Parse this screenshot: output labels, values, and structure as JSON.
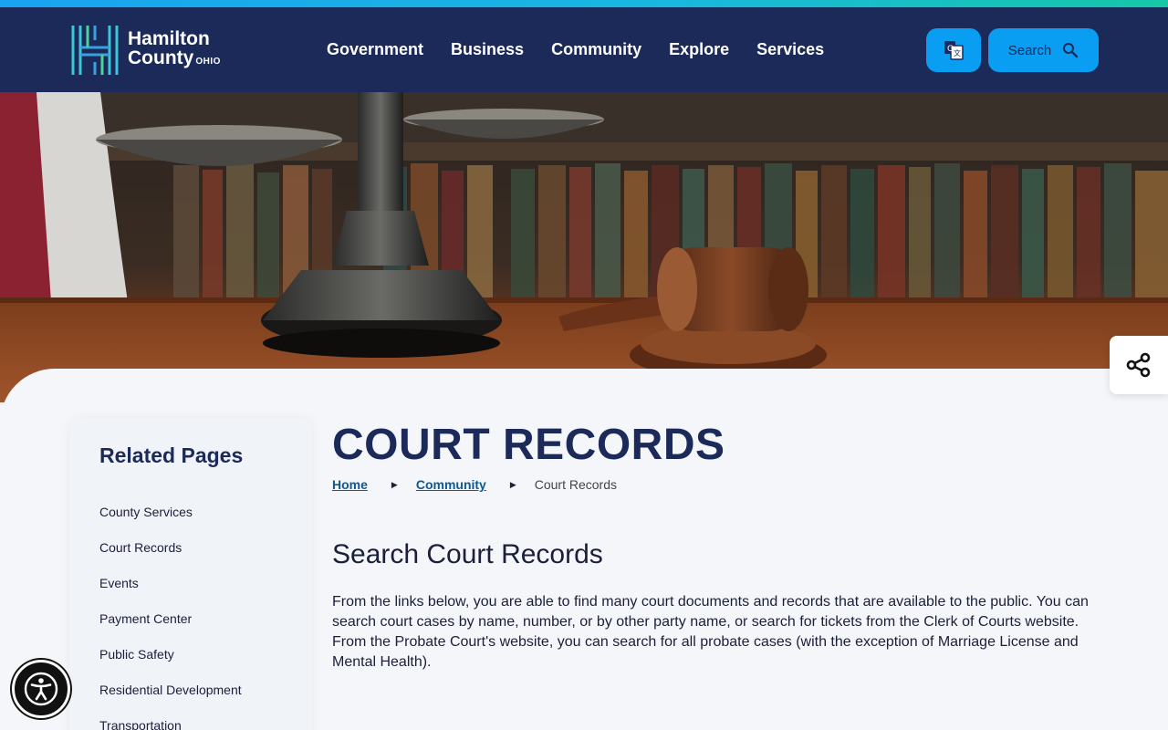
{
  "brand": {
    "line1": "Hamilton",
    "line2": "County",
    "state": "OHIO"
  },
  "nav": [
    "Government",
    "Business",
    "Community",
    "Explore",
    "Services"
  ],
  "header": {
    "search_label": "Search",
    "translate_icon": "translate-icon",
    "search_icon": "search-icon"
  },
  "sidebar": {
    "title": "Related Pages",
    "items": [
      "County Services",
      "Court Records",
      "Events",
      "Payment Center",
      "Public Safety",
      "Residential Development",
      "Transportation"
    ]
  },
  "page": {
    "title": "COURT RECORDS",
    "breadcrumb": {
      "home": "Home",
      "parent": "Community",
      "current": "Court Records"
    },
    "heading": "Search Court Records",
    "intro": "From the links below, you are able to find many court documents and records that are available to the public. You can search court cases by name, number, or by other party name, or search for tickets from the Clerk of Courts website. From the Probate Court's website, you can search for all probate cases (with the exception of Marriage License and Mental Health)."
  },
  "colors": {
    "navy": "#1c2a5a",
    "accent": "#0a9ef2",
    "link": "#0c5a92"
  },
  "icons": {
    "share": "share-icon",
    "accessibility": "accessibility-icon"
  }
}
